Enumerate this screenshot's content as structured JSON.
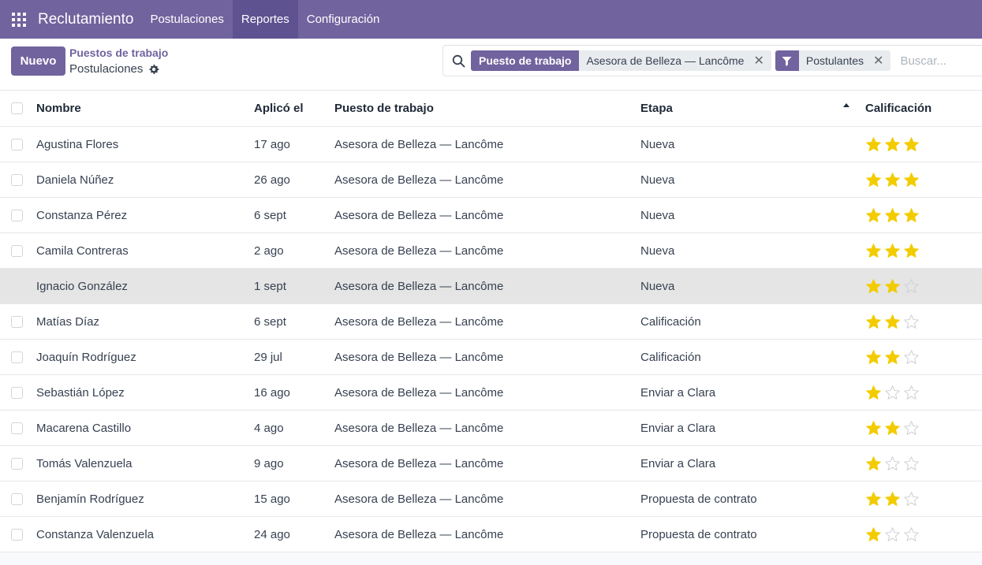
{
  "navbar": {
    "apps_icon": "apps-grid-icon",
    "brand": "Reclutamiento",
    "menu": [
      {
        "label": "Postulaciones",
        "active": false
      },
      {
        "label": "Reportes",
        "active": true
      },
      {
        "label": "Configuración",
        "active": false
      }
    ]
  },
  "control": {
    "new_button": "Nuevo",
    "breadcrumb": "Puestos de trabajo",
    "page_title": "Postulaciones",
    "gear_icon": "gear-icon"
  },
  "search": {
    "icon": "search-icon",
    "facets": [
      {
        "label": "Puesto de trabajo",
        "value": "Asesora de Belleza — Lancôme"
      },
      {
        "icon": "filter-icon",
        "value": "Postulantes"
      }
    ],
    "placeholder": "Buscar..."
  },
  "table": {
    "columns": {
      "name": "Nombre",
      "date": "Aplicó el",
      "job": "Puesto de trabajo",
      "stage": "Etapa",
      "rating": "Calificación"
    },
    "rows": [
      {
        "name": "Agustina Flores",
        "date": "17 ago",
        "job": "Asesora de Belleza — Lancôme",
        "stage": "Nueva",
        "rating": 3
      },
      {
        "name": "Daniela Núñez",
        "date": "26 ago",
        "job": "Asesora de Belleza — Lancôme",
        "stage": "Nueva",
        "rating": 3
      },
      {
        "name": "Constanza Pérez",
        "date": "6 sept",
        "job": "Asesora de Belleza — Lancôme",
        "stage": "Nueva",
        "rating": 3
      },
      {
        "name": "Camila Contreras",
        "date": "2 ago",
        "job": "Asesora de Belleza — Lancôme",
        "stage": "Nueva",
        "rating": 3
      },
      {
        "name": "Ignacio González",
        "date": "1 sept",
        "job": "Asesora de Belleza — Lancôme",
        "stage": "Nueva",
        "rating": 2,
        "hover": true
      },
      {
        "name": "Matías Díaz",
        "date": "6 sept",
        "job": "Asesora de Belleza — Lancôme",
        "stage": "Calificación",
        "rating": 2
      },
      {
        "name": "Joaquín Rodríguez",
        "date": "29 jul",
        "job": "Asesora de Belleza — Lancôme",
        "stage": "Calificación",
        "rating": 2
      },
      {
        "name": "Sebastián López",
        "date": "16 ago",
        "job": "Asesora de Belleza — Lancôme",
        "stage": "Enviar a Clara",
        "rating": 1
      },
      {
        "name": "Macarena Castillo",
        "date": "4 ago",
        "job": "Asesora de Belleza — Lancôme",
        "stage": "Enviar a Clara",
        "rating": 2
      },
      {
        "name": "Tomás Valenzuela",
        "date": "9 ago",
        "job": "Asesora de Belleza — Lancôme",
        "stage": "Enviar a Clara",
        "rating": 1
      },
      {
        "name": "Benjamín Rodríguez",
        "date": "15 ago",
        "job": "Asesora de Belleza — Lancôme",
        "stage": "Propuesta de contrato",
        "rating": 2
      },
      {
        "name": "Constanza Valenzuela",
        "date": "24 ago",
        "job": "Asesora de Belleza — Lancôme",
        "stage": "Propuesta de contrato",
        "rating": 1
      }
    ],
    "max_rating": 3
  },
  "colors": {
    "brand": "#71639e",
    "star": "#f3cc00",
    "hover_row": "#e5e5e5"
  }
}
